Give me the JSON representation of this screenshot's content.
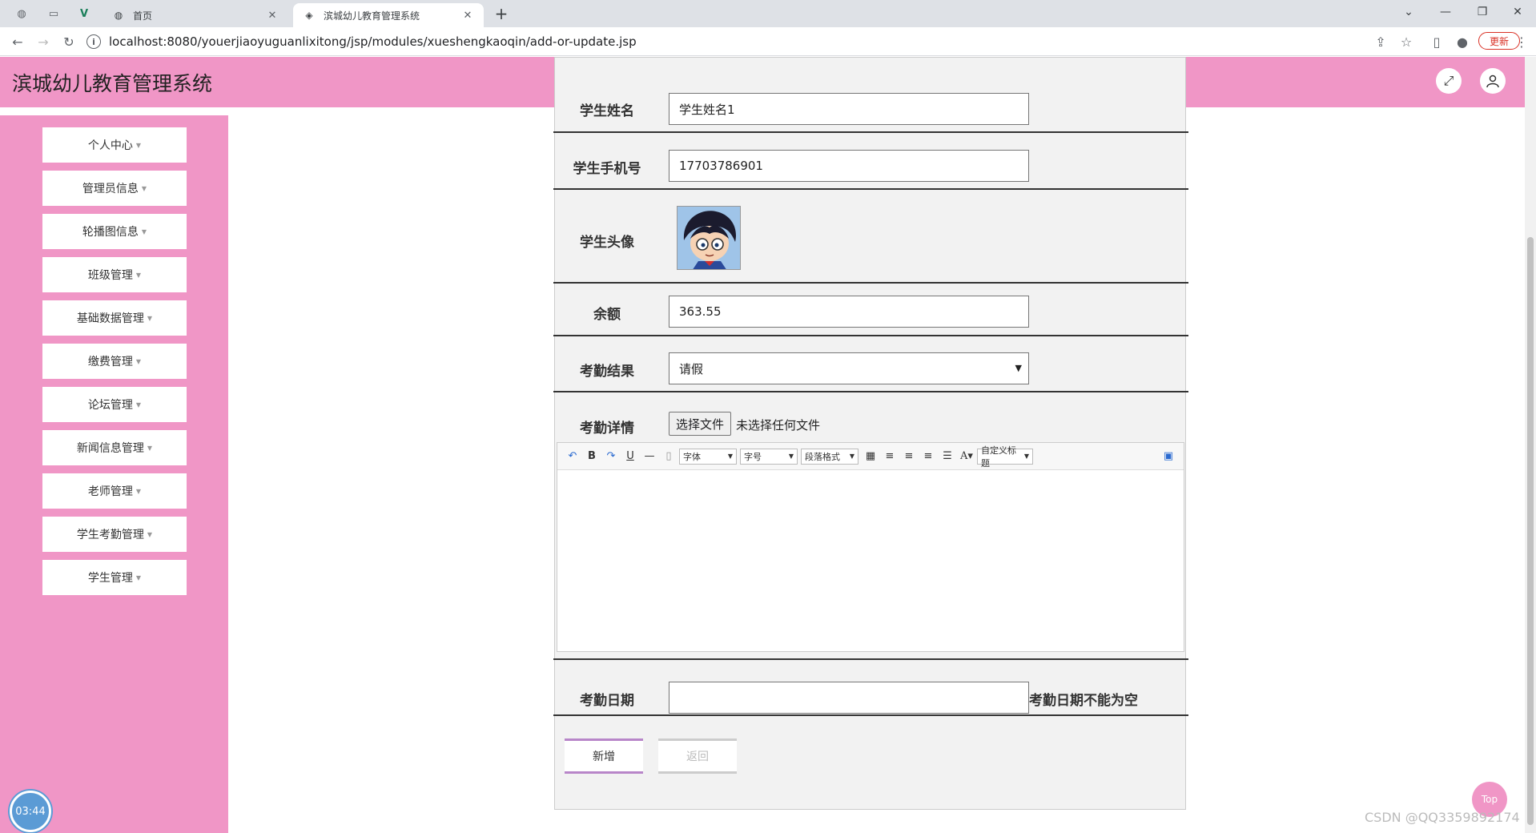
{
  "browser": {
    "tabs": [
      {
        "title": "首页",
        "active": false
      },
      {
        "title": "滨城幼儿教育管理系统",
        "active": true
      }
    ],
    "url": "localhost:8080/youerjiaoyuguanlixitong/jsp/modules/xueshengkaoqin/add-or-update.jsp",
    "update_label": "更新"
  },
  "app": {
    "title": "滨城幼儿教育管理系统"
  },
  "sidebar": {
    "items": [
      {
        "label": "个人中心"
      },
      {
        "label": "管理员信息"
      },
      {
        "label": "轮播图信息"
      },
      {
        "label": "班级管理"
      },
      {
        "label": "基础数据管理"
      },
      {
        "label": "缴费管理"
      },
      {
        "label": "论坛管理"
      },
      {
        "label": "新闻信息管理"
      },
      {
        "label": "老师管理"
      },
      {
        "label": "学生考勤管理"
      },
      {
        "label": "学生管理"
      }
    ]
  },
  "form": {
    "name_label": "学生姓名",
    "name_value": "学生姓名1",
    "phone_label": "学生手机号",
    "phone_value": "17703786901",
    "avatar_label": "学生头像",
    "balance_label": "余额",
    "balance_value": "363.55",
    "result_label": "考勤结果",
    "result_value": "请假",
    "detail_label": "考勤详情",
    "file_button": "选择文件",
    "file_status": "未选择任何文件",
    "editor": {
      "font_label": "字体",
      "size_label": "字号",
      "format_label": "段落格式",
      "custom_title_label": "自定义标题"
    },
    "date_label": "考勤日期",
    "date_value": "",
    "date_error": "考勤日期不能为空",
    "submit_label": "新增",
    "back_label": "返回"
  },
  "widgets": {
    "clock": "03:44",
    "top": "Top",
    "watermark": "CSDN @QQ3359892174"
  },
  "colors": {
    "theme_pink": "#f096c6",
    "accent_purple": "#b886c9",
    "clock_blue": "#5b9bd5"
  }
}
